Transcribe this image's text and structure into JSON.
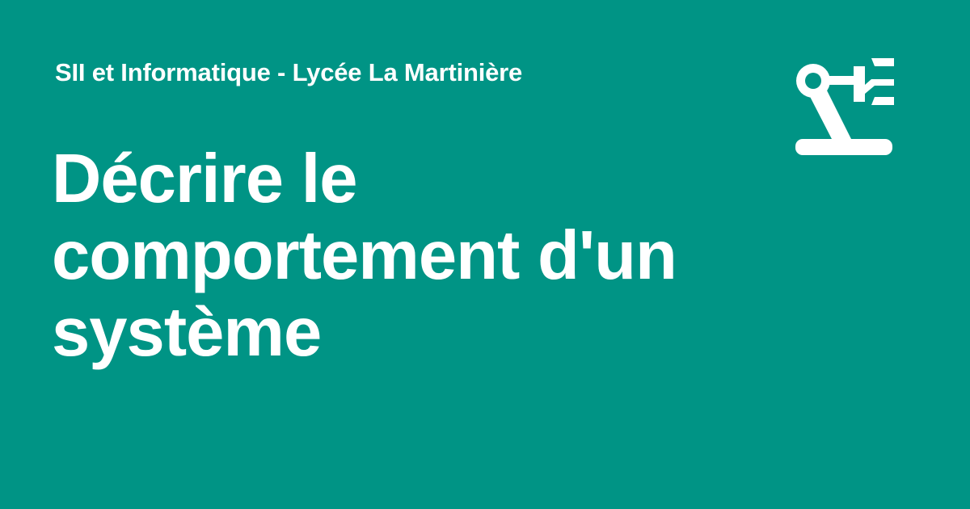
{
  "site": {
    "name": "SII et Informatique - Lycée La Martinière"
  },
  "page": {
    "title": "Décrire le comportement d'un système"
  },
  "logo": {
    "icon": "robotic-arm-icon"
  },
  "colors": {
    "background": "#009485",
    "foreground": "#ffffff"
  }
}
